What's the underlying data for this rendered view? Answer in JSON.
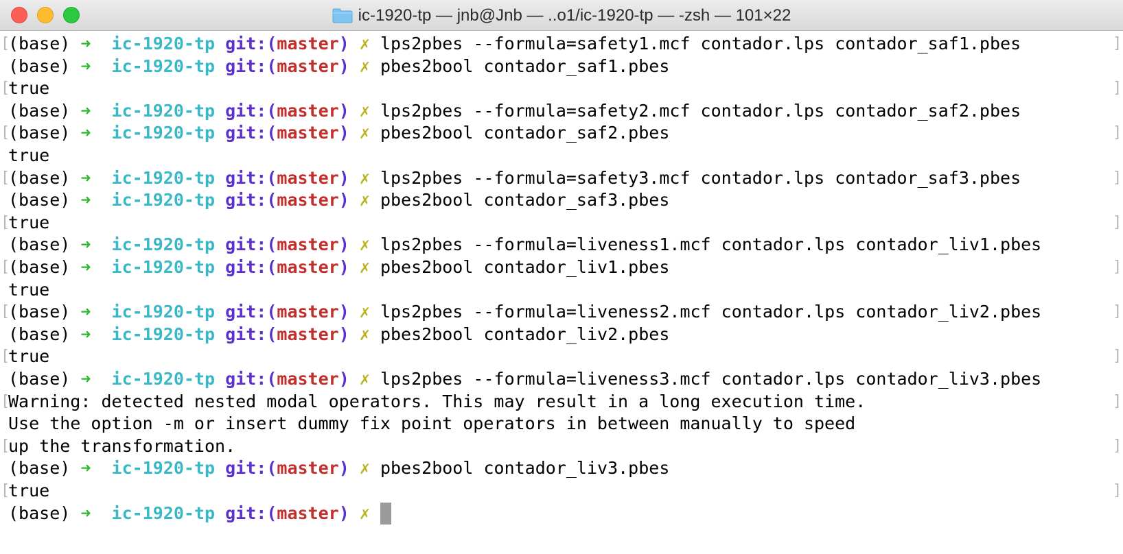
{
  "window": {
    "title": "ic-1920-tp — jnb@Jnb — ..o1/ic-1920-tp — -zsh — 101×22"
  },
  "icons": {
    "close": "close-traffic-light",
    "minimize": "minimize-traffic-light",
    "zoom": "zoom-traffic-light",
    "folder": "folder-icon"
  },
  "colors": {
    "arrow": "#2db82d",
    "dir": "#3ab8c6",
    "git": "#5b30cf",
    "branch": "#c0302d",
    "dirty": "#b9b21c"
  },
  "prompt": {
    "env": "(base)",
    "arrow": "➜",
    "dir": "ic-1920-tp",
    "git_prefix": "git:(",
    "branch": "master",
    "git_suffix": ")",
    "dirty": "✗"
  },
  "lines": [
    {
      "type": "prompt",
      "cmd": "lps2pbes --formula=safety1.mcf contador.lps contador_saf1.pbes",
      "lb": true,
      "rb": true
    },
    {
      "type": "prompt",
      "cmd": "pbes2bool contador_saf1.pbes",
      "lb": false,
      "rb": false
    },
    {
      "type": "output",
      "text": "true",
      "lb": true,
      "rb": true
    },
    {
      "type": "prompt",
      "cmd": "lps2pbes --formula=safety2.mcf contador.lps contador_saf2.pbes",
      "lb": false,
      "rb": false
    },
    {
      "type": "prompt",
      "cmd": "pbes2bool contador_saf2.pbes",
      "lb": true,
      "rb": true
    },
    {
      "type": "output",
      "text": "true",
      "lb": false,
      "rb": false
    },
    {
      "type": "prompt",
      "cmd": "lps2pbes --formula=safety3.mcf contador.lps contador_saf3.pbes",
      "lb": true,
      "rb": true
    },
    {
      "type": "prompt",
      "cmd": "pbes2bool contador_saf3.pbes",
      "lb": false,
      "rb": false
    },
    {
      "type": "output",
      "text": "true",
      "lb": true,
      "rb": true
    },
    {
      "type": "prompt",
      "cmd": "lps2pbes --formula=liveness1.mcf contador.lps contador_liv1.pbes",
      "lb": false,
      "rb": false
    },
    {
      "type": "prompt",
      "cmd": "pbes2bool contador_liv1.pbes",
      "lb": true,
      "rb": true
    },
    {
      "type": "output",
      "text": "true",
      "lb": false,
      "rb": false
    },
    {
      "type": "prompt",
      "cmd": "lps2pbes --formula=liveness2.mcf contador.lps contador_liv2.pbes",
      "lb": true,
      "rb": true
    },
    {
      "type": "prompt",
      "cmd": "pbes2bool contador_liv2.pbes",
      "lb": false,
      "rb": false
    },
    {
      "type": "output",
      "text": "true",
      "lb": true,
      "rb": true
    },
    {
      "type": "prompt",
      "cmd": "lps2pbes --formula=liveness3.mcf contador.lps contador_liv3.pbes",
      "lb": false,
      "rb": false
    },
    {
      "type": "output",
      "text": "Warning: detected nested modal operators. This may result in a long execution time.",
      "lb": true,
      "rb": true
    },
    {
      "type": "output",
      "text": "Use the option -m or insert dummy fix point operators in between manually to speed",
      "lb": false,
      "rb": false
    },
    {
      "type": "output",
      "text": "up the transformation.",
      "lb": true,
      "rb": true
    },
    {
      "type": "prompt",
      "cmd": "pbes2bool contador_liv3.pbes",
      "lb": false,
      "rb": false
    },
    {
      "type": "output",
      "text": "true",
      "lb": true,
      "rb": true
    },
    {
      "type": "prompt",
      "cmd": "",
      "cursor": true,
      "lb": false,
      "rb": false
    }
  ]
}
